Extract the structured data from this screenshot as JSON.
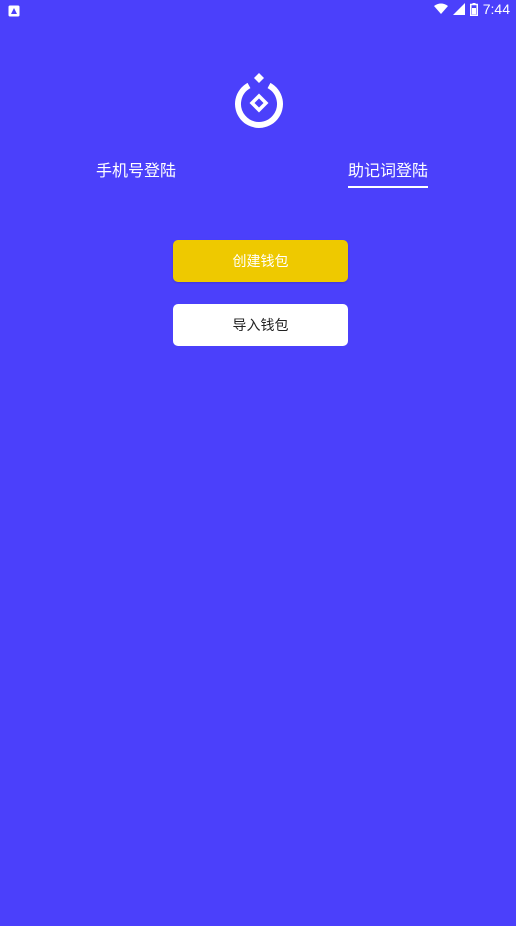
{
  "status_bar": {
    "time": "7:44",
    "notification_icon": "app-notification-icon",
    "wifi_icon": "wifi-icon",
    "signal_icon": "cell-signal-icon",
    "battery_icon": "battery-icon"
  },
  "logo": {
    "icon": "wallet-logo-icon"
  },
  "tabs": [
    {
      "label": "手机号登陆",
      "active": false
    },
    {
      "label": "助记词登陆",
      "active": true
    }
  ],
  "actions": {
    "create_label": "创建钱包",
    "import_label": "导入钱包"
  },
  "colors": {
    "background": "#4b40fb",
    "accent_yellow": "#eec900",
    "white": "#ffffff"
  }
}
